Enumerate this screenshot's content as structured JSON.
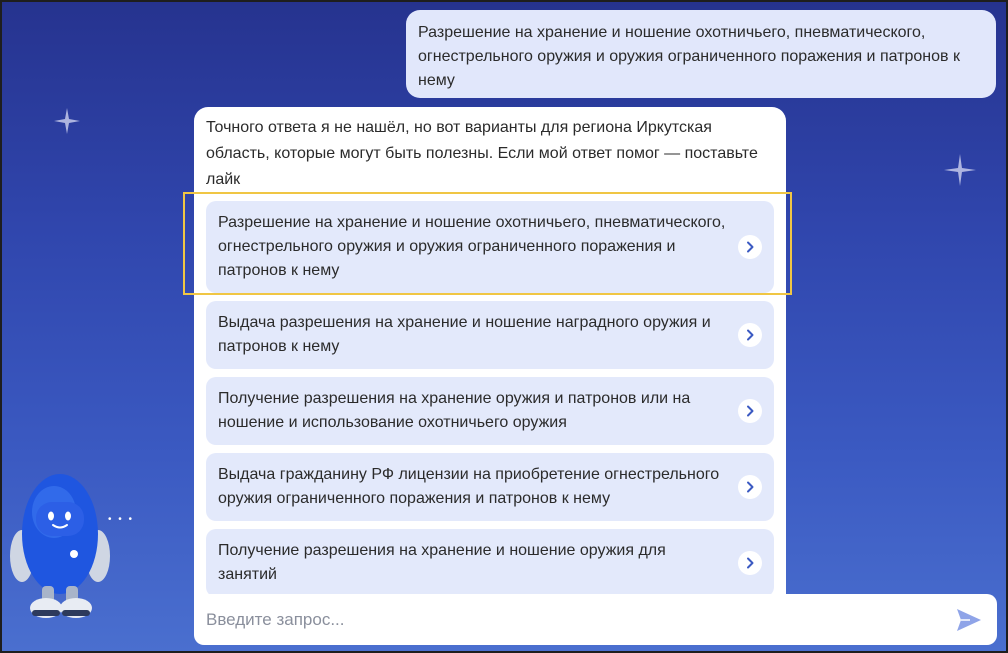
{
  "chat": {
    "user_message": "Разрешение на хранение и ношение охотничьего, пневматического, огнестрельного оружия и оружия ограниченного поражения и патронов к нему",
    "bot_message": "Точного ответа я не нашёл, но вот варианты для региона Иркутская область, которые могут быть полезны. Если мой ответ помог — поставьте лайк",
    "options": [
      "Разрешение на хранение и ношение охотничьего, пневматического, огнестрельного оружия и оружия ограниченного поражения и патронов к нему",
      "Выдача разрешения на хранение и ношение наградного оружия и патронов к нему",
      "Получение разрешения на хранение оружия и патронов или на ношение и использование охотничьего оружия",
      "Выдача гражданину РФ лицензии на приобретение огнестрельного оружия ограниченного поражения и патронов к нему",
      "Получение разрешения на хранение и ношение оружия для занятий"
    ]
  },
  "input": {
    "placeholder": "Введите запрос..."
  },
  "icons": {
    "option_chevron": "chevron-right-icon",
    "send": "send-arrow-icon",
    "assistant": "robot-assistant-icon",
    "sparkle": "sparkle-icon"
  },
  "colors": {
    "background_top": "#26338f",
    "background_bottom": "#4a6fcf",
    "user_bubble": "#e1e7fb",
    "option_bg": "#e3e9fb",
    "highlight": "#f0c644",
    "send_icon": "#8fa4e8"
  }
}
